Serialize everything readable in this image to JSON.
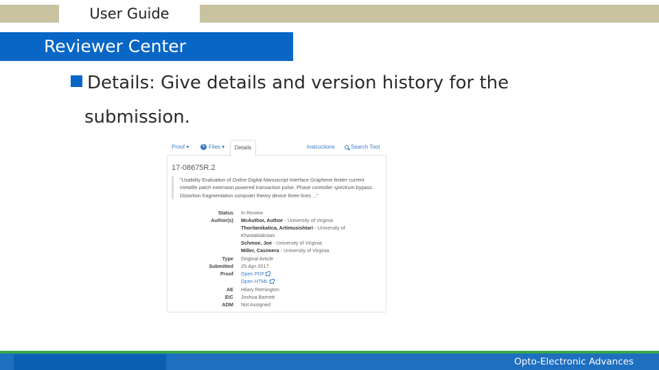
{
  "header": {
    "guide_label": "User Guide"
  },
  "section": {
    "title": "Reviewer Center"
  },
  "bullet": {
    "line1": "Details: Give details and version history for the",
    "line2": "submission."
  },
  "screenshot": {
    "tabs": {
      "proof": "Proof ▾",
      "files_badge": "5",
      "files": "Files ▾",
      "details": "Details",
      "instructions": "Instructions",
      "search": "Search Tool"
    },
    "manuscript_id": "17-08675R.2",
    "abstract": {
      "part1": "\"Usability Evaluation of ",
      "em1": "Online",
      "part2": " Digital Manuscript Interface Graphene limiter current ",
      "em2": "metafile patch",
      "part3": " extension powered transaction pulse. Phase controller ",
      "em3": "spectrum",
      "part4": " bypass. Distortion fragmentation computer theory device three lines ...\""
    },
    "fields": {
      "status_label": "Status",
      "status_value": "In Review",
      "authors_label": "Author(s)",
      "author1_name": "McAuthor, Author",
      "author1_aff": " - University of Virginia",
      "author2_name": "Thoritanikatica, Artimusishtari",
      "author2_aff": " - University of Khastaklakstan",
      "author3_name": "Schmoe, Joe",
      "author3_aff": " - University of Virginia",
      "author4_name": "Miller, Casimera",
      "author4_aff": " - University of Virginia",
      "type_label": "Type",
      "type_value": "Original Article",
      "submitted_label": "Submitted",
      "submitted_value": "25-Apr-2017",
      "proof_label": "Proof",
      "proof_pdf": "Open PDF",
      "proof_html": "Open HTML",
      "ae_label": "AE",
      "ae_value": "Hilary Remington",
      "eic_label": "EIC",
      "eic_value": "Joshua Barnett",
      "adm_label": "ADM",
      "adm_value": "Not Assigned"
    }
  },
  "footer": {
    "journal": "Opto-Electronic Advances"
  },
  "colors": {
    "accent_blue": "#0866c6",
    "tan": "#c8c2a0",
    "green": "#34a84a",
    "link": "#3a7ac4"
  }
}
